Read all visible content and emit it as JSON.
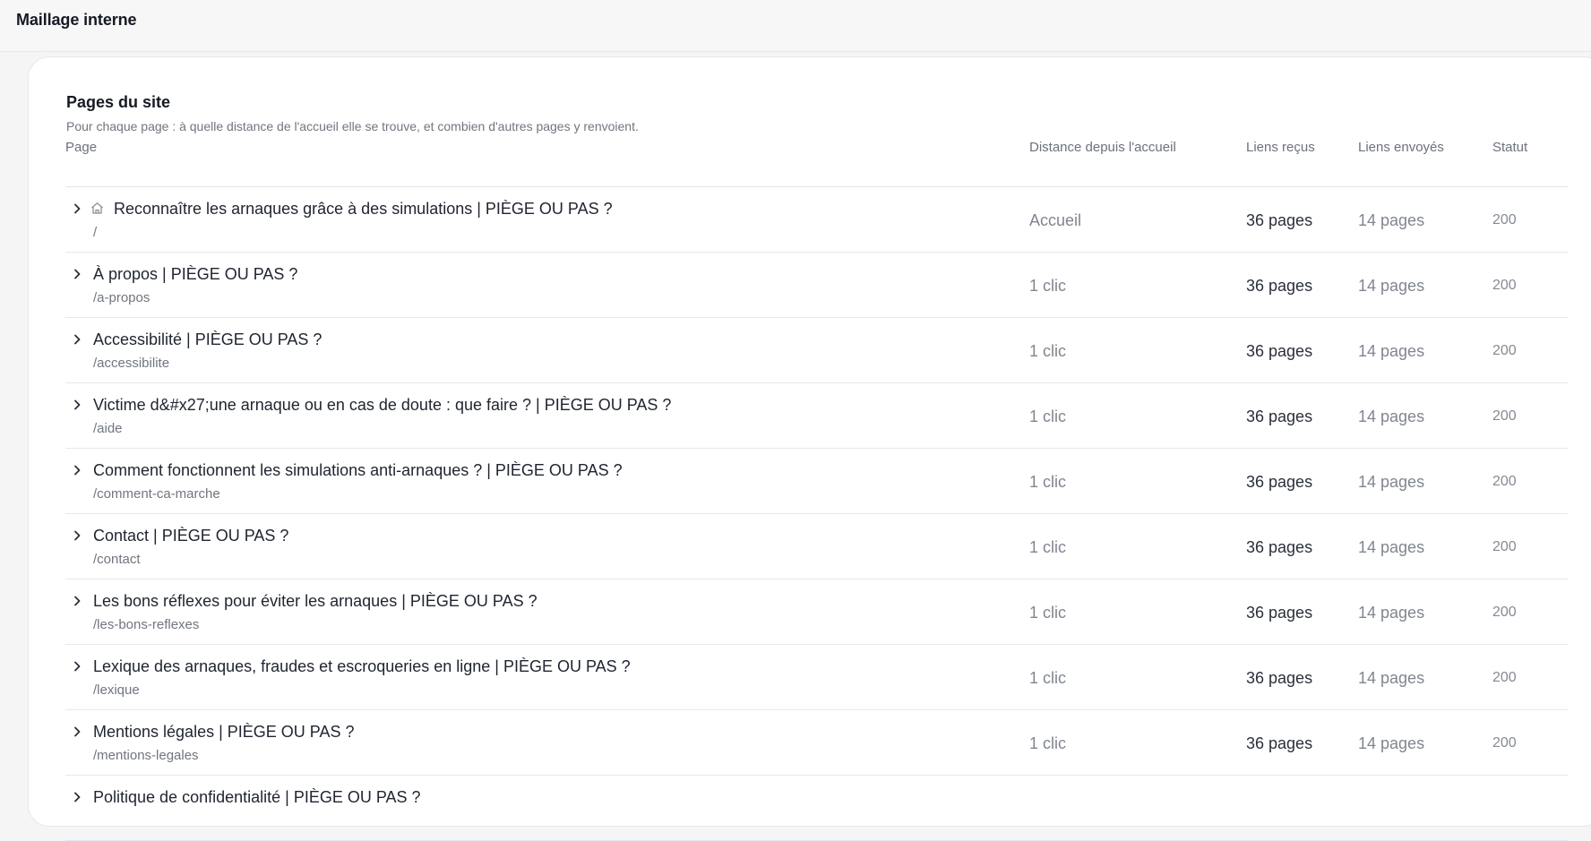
{
  "header": {
    "title": "Maillage interne"
  },
  "section": {
    "title": "Pages du site",
    "subtitle": "Pour chaque page : à quelle distance de l'accueil elle se trouve, et combien d'autres pages y renvoient."
  },
  "table": {
    "columns": {
      "page": "Page",
      "distance": "Distance depuis l'accueil",
      "received": "Liens reçus",
      "sent": "Liens envoyés",
      "status": "Statut"
    },
    "rows": [
      {
        "title": "Reconnaître les arnaques grâce à des simulations | PIÈGE OU PAS ?",
        "path": "/",
        "distance": "Accueil",
        "received": "36 pages",
        "sent": "14 pages",
        "status": "200",
        "home": true
      },
      {
        "title": "À propos | PIÈGE OU PAS ?",
        "path": "/a-propos",
        "distance": "1 clic",
        "received": "36 pages",
        "sent": "14 pages",
        "status": "200"
      },
      {
        "title": "Accessibilité | PIÈGE OU PAS ?",
        "path": "/accessibilite",
        "distance": "1 clic",
        "received": "36 pages",
        "sent": "14 pages",
        "status": "200"
      },
      {
        "title": "Victime d&#x27;une arnaque ou en cas de doute : que faire ? | PIÈGE OU PAS ?",
        "path": "/aide",
        "distance": "1 clic",
        "received": "36 pages",
        "sent": "14 pages",
        "status": "200"
      },
      {
        "title": "Comment fonctionnent les simulations anti-arnaques ? | PIÈGE OU PAS ?",
        "path": "/comment-ca-marche",
        "distance": "1 clic",
        "received": "36 pages",
        "sent": "14 pages",
        "status": "200"
      },
      {
        "title": "Contact | PIÈGE OU PAS ?",
        "path": "/contact",
        "distance": "1 clic",
        "received": "36 pages",
        "sent": "14 pages",
        "status": "200"
      },
      {
        "title": "Les bons réflexes pour éviter les arnaques | PIÈGE OU PAS ?",
        "path": "/les-bons-reflexes",
        "distance": "1 clic",
        "received": "36 pages",
        "sent": "14 pages",
        "status": "200"
      },
      {
        "title": "Lexique des arnaques, fraudes et escroqueries en ligne | PIÈGE OU PAS ?",
        "path": "/lexique",
        "distance": "1 clic",
        "received": "36 pages",
        "sent": "14 pages",
        "status": "200"
      },
      {
        "title": "Mentions légales | PIÈGE OU PAS ?",
        "path": "/mentions-legales",
        "distance": "1 clic",
        "received": "36 pages",
        "sent": "14 pages",
        "status": "200"
      },
      {
        "title": "Politique de confidentialité | PIÈGE OU PAS ?",
        "path": "",
        "distance": "",
        "received": "",
        "sent": "",
        "status": ""
      }
    ]
  },
  "icons": {
    "expand": "chevron-right-icon",
    "home": "home-icon"
  },
  "colors": {
    "background": "#f5f5f6",
    "card": "#ffffff",
    "text": "#1f2430",
    "muted": "#70757f",
    "border": "#e7e8eb"
  }
}
